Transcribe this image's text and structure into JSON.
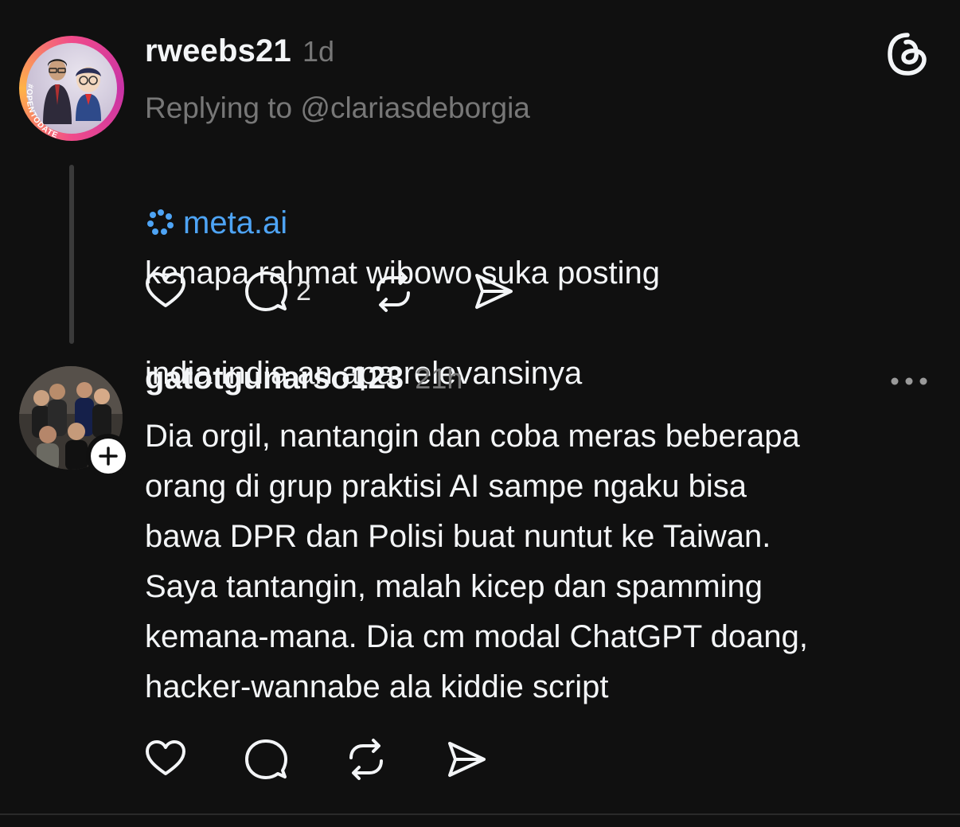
{
  "post1": {
    "username": "rweebs21",
    "time": "1d",
    "reply_to": "Replying to @clariasdeborgia",
    "mention": "meta.ai",
    "text_line1": "kenapa rahmat wibowo suka posting",
    "text_line2": "india india an apa relevansinya",
    "reply_count": "2",
    "avatar_ring_text": "#OPENTODATE"
  },
  "post2": {
    "username": "gatotgunarso123",
    "time": "21h",
    "text": "Dia orgil, nantangin dan coba meras beberapa\norang di grup praktisi AI sampe ngaku bisa\nbawa DPR dan Polisi buat nuntut ke Taiwan.\nSaya tantangin, malah kicep dan spamming\nkemana-mana. Dia cm modal ChatGPT doang,\nhacker-wannabe ala kiddie script"
  },
  "icons": {
    "app_logo": "threads-logo-icon",
    "like": "heart-icon",
    "comment": "comment-bubble-icon",
    "repost": "repost-icon",
    "share": "send-icon",
    "more": "more-dots-icon",
    "follow": "plus-icon",
    "meta_ai": "meta-ai-icon"
  },
  "colors": {
    "background": "#101010",
    "primary_text": "#f3f5f7",
    "secondary_text": "#777777",
    "link": "#4ea4f5",
    "avatar_ring": "#e04592"
  }
}
